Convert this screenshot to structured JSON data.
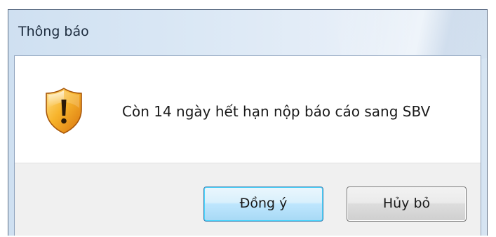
{
  "dialog": {
    "title": "Thông báo",
    "icon": "shield-warning-icon",
    "message": "Còn 14 ngày hết hạn nộp báo cáo sang SBV"
  },
  "buttons": {
    "ok_label": "Đồng ý",
    "cancel_label": "Hủy bỏ"
  },
  "colors": {
    "titlebar": "#dbe8f5",
    "button_bar": "#f0f0f0",
    "default_button_border": "#3c7fb1",
    "shield_orange": "#f4a21c"
  }
}
